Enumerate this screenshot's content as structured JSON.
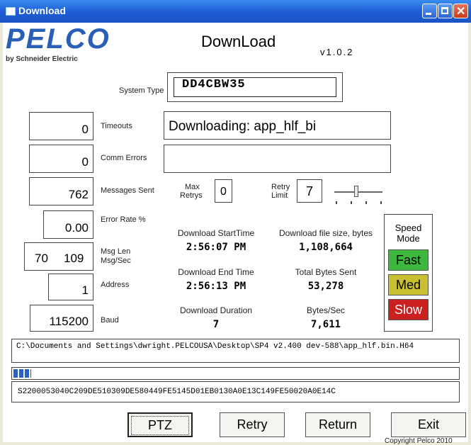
{
  "window": {
    "title": "Download"
  },
  "header": {
    "logo_text": "PELCO",
    "logo_sub": "by Schneider Electric",
    "app_title": "DownLoad",
    "version": "v1.0.2"
  },
  "system_type": {
    "label": "System Type",
    "value": "DD4CBW35"
  },
  "stats": {
    "timeouts": {
      "value": "0",
      "label": "Timeouts"
    },
    "comm_errors": {
      "value": "0",
      "label": "Comm Errors"
    },
    "messages_sent": {
      "value": "762",
      "label": "Messages Sent"
    },
    "error_rate": {
      "value": "0.00",
      "label": "Error Rate %"
    },
    "msg_len": {
      "len": "70",
      "rate": "109",
      "label1": "Msg Len",
      "label2": "Msg/Sec"
    },
    "address": {
      "value": "1",
      "label": "Address"
    },
    "baud": {
      "value": "115200",
      "label": "Baud"
    }
  },
  "status": {
    "line1": "Downloading: app_hlf_bi",
    "line2": ""
  },
  "retry": {
    "max_label1": "Max",
    "max_label2": "Retrys",
    "max_value": "0",
    "limit_label1": "Retry",
    "limit_label2": "Limit",
    "limit_value": "7",
    "slider_level": 0.45
  },
  "info": {
    "start_label": "Download StartTime",
    "start_value": "2:56:07 PM",
    "end_label": "Download End Time",
    "end_value": "2:56:13 PM",
    "duration_label": "Download Duration",
    "duration_value": "7",
    "filesize_label": "Download file size, bytes",
    "filesize_value": "1,108,664",
    "total_label": "Total Bytes Sent",
    "total_value": "53,278",
    "bps_label": "Bytes/Sec",
    "bps_value": "7,611"
  },
  "speed": {
    "label1": "Speed",
    "label2": "Mode",
    "fast": "Fast",
    "med": "Med",
    "slow": "Slow",
    "colors": {
      "fast": "#3cb83c",
      "med": "#c8c030",
      "slow": "#cc2020"
    }
  },
  "path": {
    "text": "C:\\Documents and Settings\\dwright.PELCOUSA\\Desktop\\SP4 v2.400 dev-588\\app_hlf.bin.H64"
  },
  "progress": {
    "level": 0.04,
    "color": "#2a5fc8"
  },
  "record": {
    "text": "S2200053040C209DE510309DE580449FE5145D01EB0130A0E13C149FE50020A0E14C"
  },
  "buttons": {
    "ptz": "PTZ",
    "retry": "Retry",
    "return": "Return",
    "exit": "Exit"
  },
  "copyright": "Copyright Pelco 2010"
}
